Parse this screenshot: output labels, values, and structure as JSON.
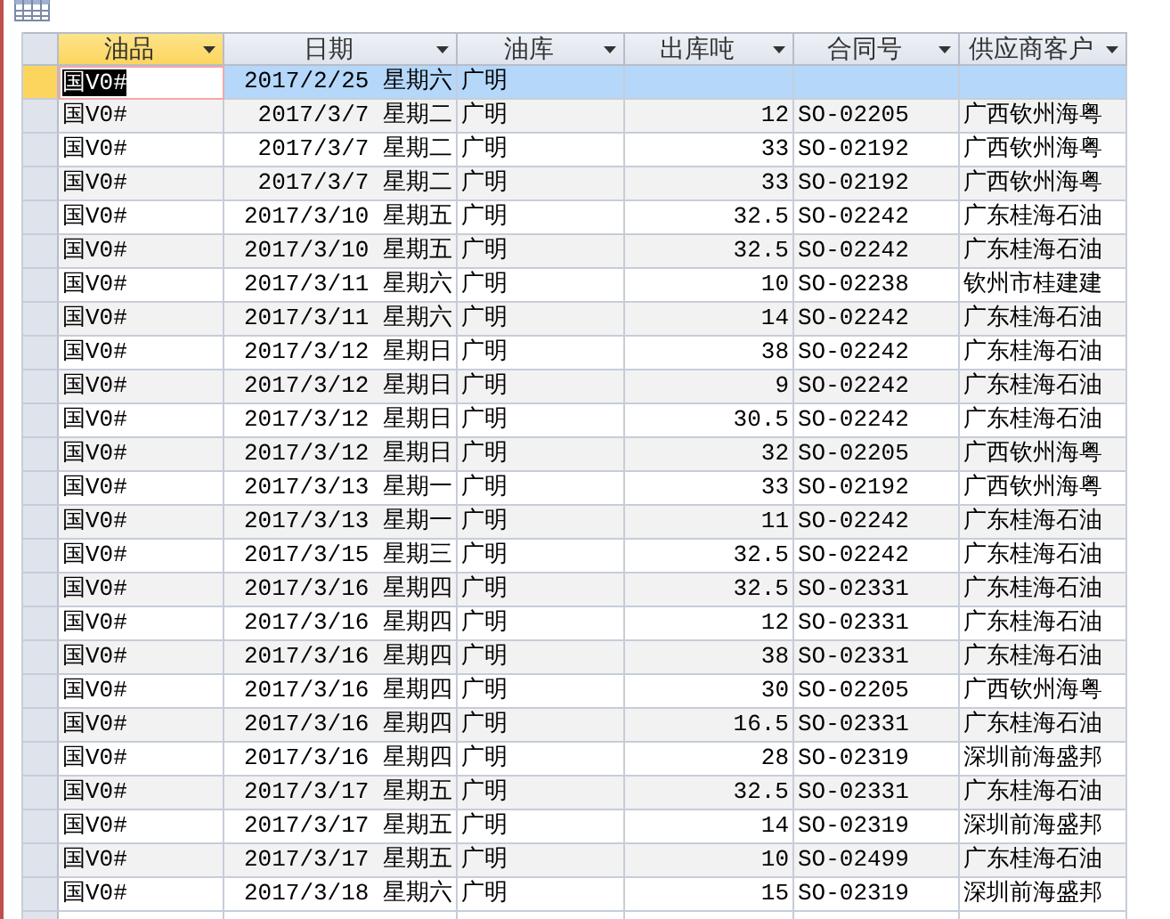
{
  "columns": [
    {
      "label": "油品",
      "kind": "text",
      "selected": true
    },
    {
      "label": "日期",
      "kind": "date",
      "selected": false
    },
    {
      "label": "油库",
      "kind": "text",
      "selected": false
    },
    {
      "label": "出库吨",
      "kind": "number",
      "selected": false
    },
    {
      "label": "合同号",
      "kind": "text",
      "selected": false
    },
    {
      "label": "供应商客户",
      "kind": "text",
      "selected": false
    }
  ],
  "rows": [
    {
      "selected": true,
      "cells": [
        "国V0#",
        "2017/2/25 星期六",
        "广明"
      ]
    },
    {
      "selected": false,
      "cells": [
        "国V0#",
        "2017/3/7 星期二",
        "广明",
        "12",
        "SO-02205",
        "广西钦州海粤"
      ]
    },
    {
      "selected": false,
      "cells": [
        "国V0#",
        "2017/3/7 星期二",
        "广明",
        "33",
        "SO-02192",
        "广西钦州海粤"
      ]
    },
    {
      "selected": false,
      "cells": [
        "国V0#",
        "2017/3/7 星期二",
        "广明",
        "33",
        "SO-02192",
        "广西钦州海粤"
      ]
    },
    {
      "selected": false,
      "cells": [
        "国V0#",
        "2017/3/10 星期五",
        "广明",
        "32.5",
        "SO-02242",
        "广东桂海石油"
      ]
    },
    {
      "selected": false,
      "cells": [
        "国V0#",
        "2017/3/10 星期五",
        "广明",
        "32.5",
        "SO-02242",
        "广东桂海石油"
      ]
    },
    {
      "selected": false,
      "cells": [
        "国V0#",
        "2017/3/11 星期六",
        "广明",
        "10",
        "SO-02238",
        "钦州市桂建建"
      ]
    },
    {
      "selected": false,
      "cells": [
        "国V0#",
        "2017/3/11 星期六",
        "广明",
        "14",
        "SO-02242",
        "广东桂海石油"
      ]
    },
    {
      "selected": false,
      "cells": [
        "国V0#",
        "2017/3/12 星期日",
        "广明",
        "38",
        "SO-02242",
        "广东桂海石油"
      ]
    },
    {
      "selected": false,
      "cells": [
        "国V0#",
        "2017/3/12 星期日",
        "广明",
        "9",
        "SO-02242",
        "广东桂海石油"
      ]
    },
    {
      "selected": false,
      "cells": [
        "国V0#",
        "2017/3/12 星期日",
        "广明",
        "30.5",
        "SO-02242",
        "广东桂海石油"
      ]
    },
    {
      "selected": false,
      "cells": [
        "国V0#",
        "2017/3/12 星期日",
        "广明",
        "32",
        "SO-02205",
        "广西钦州海粤"
      ]
    },
    {
      "selected": false,
      "cells": [
        "国V0#",
        "2017/3/13 星期一",
        "广明",
        "33",
        "SO-02192",
        "广西钦州海粤"
      ]
    },
    {
      "selected": false,
      "cells": [
        "国V0#",
        "2017/3/13 星期一",
        "广明",
        "11",
        "SO-02242",
        "广东桂海石油"
      ]
    },
    {
      "selected": false,
      "cells": [
        "国V0#",
        "2017/3/15 星期三",
        "广明",
        "32.5",
        "SO-02242",
        "广东桂海石油"
      ]
    },
    {
      "selected": false,
      "cells": [
        "国V0#",
        "2017/3/16 星期四",
        "广明",
        "32.5",
        "SO-02331",
        "广东桂海石油"
      ]
    },
    {
      "selected": false,
      "cells": [
        "国V0#",
        "2017/3/16 星期四",
        "广明",
        "12",
        "SO-02331",
        "广东桂海石油"
      ]
    },
    {
      "selected": false,
      "cells": [
        "国V0#",
        "2017/3/16 星期四",
        "广明",
        "38",
        "SO-02331",
        "广东桂海石油"
      ]
    },
    {
      "selected": false,
      "cells": [
        "国V0#",
        "2017/3/16 星期四",
        "广明",
        "30",
        "SO-02205",
        "广西钦州海粤"
      ]
    },
    {
      "selected": false,
      "cells": [
        "国V0#",
        "2017/3/16 星期四",
        "广明",
        "16.5",
        "SO-02331",
        "广东桂海石油"
      ]
    },
    {
      "selected": false,
      "cells": [
        "国V0#",
        "2017/3/16 星期四",
        "广明",
        "28",
        "SO-02319",
        "深圳前海盛邦"
      ]
    },
    {
      "selected": false,
      "cells": [
        "国V0#",
        "2017/3/17 星期五",
        "广明",
        "32.5",
        "SO-02331",
        "广东桂海石油"
      ]
    },
    {
      "selected": false,
      "cells": [
        "国V0#",
        "2017/3/17 星期五",
        "广明",
        "14",
        "SO-02319",
        "深圳前海盛邦"
      ]
    },
    {
      "selected": false,
      "cells": [
        "国V0#",
        "2017/3/17 星期五",
        "广明",
        "10",
        "SO-02499",
        "广东桂海石油"
      ]
    },
    {
      "selected": false,
      "cells": [
        "国V0#",
        "2017/3/18 星期六",
        "广明",
        "15",
        "SO-02319",
        "深圳前海盛邦"
      ]
    }
  ]
}
